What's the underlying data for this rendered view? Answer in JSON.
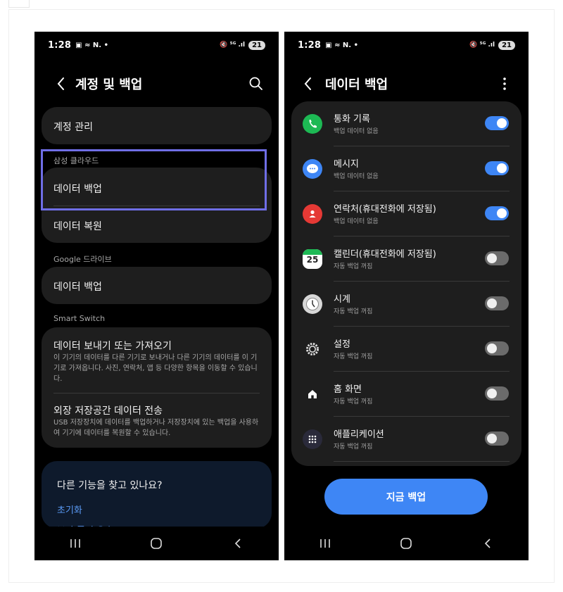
{
  "status_left": {
    "time": "1:28",
    "icons": "▣ ≈ N. •"
  },
  "status_right": {
    "icons": "🔇 ⁵ᴳ .ıl",
    "battery": "21"
  },
  "left_screen": {
    "title": "계정 및 백업",
    "account_management": "계정 관리",
    "samsung_cloud_label": "삼성 클라우드",
    "data_backup": "데이터 백업",
    "data_restore": "데이터 복원",
    "google_drive_label": "Google 드라이브",
    "google_data_backup": "데이터 백업",
    "smart_switch_label": "Smart Switch",
    "send_receive_title": "데이터 보내기 또는 가져오기",
    "send_receive_desc": "이 기기의 데이터를 다른 기기로 보내거나 다른 기기의 데이터를 이 기기로 가져옵니다. 사진, 연락처, 앱 등 다양한 항목을 이동할 수 있습니다.",
    "external_title": "외장 저장공간 데이터 전송",
    "external_desc": "USB 저장장치에 데이터를 백업하거나 저장장치에 있는 백업을 사용하여 기기에 데이터를 복원할 수 있습니다.",
    "help_title": "다른 기능을 찾고 있나요?",
    "help_link": "초기화",
    "help_link_partial": "보안 폴더 유효"
  },
  "right_screen": {
    "title": "데이터 백업",
    "items": [
      {
        "title": "통화 기록",
        "sub": "백업 데이터 없음",
        "icon": "phone-icon",
        "enabled": true,
        "color": "#1db954"
      },
      {
        "title": "메시지",
        "sub": "백업 데이터 없음",
        "icon": "message-icon",
        "enabled": true,
        "color": "#3e86f5"
      },
      {
        "title": "연락처(휴대전화에 저장됨)",
        "sub": "백업 데이터 없음",
        "icon": "contacts-icon",
        "enabled": true,
        "color": "#e53935"
      },
      {
        "title": "캘린더(휴대전화에 저장됨)",
        "sub": "자동 백업 꺼짐",
        "icon": "calendar-icon",
        "enabled": false,
        "color": "#ffffff",
        "badge": "25"
      },
      {
        "title": "시계",
        "sub": "자동 백업 꺼짐",
        "icon": "clock-icon",
        "enabled": false,
        "color": "#d8d8d8"
      },
      {
        "title": "설정",
        "sub": "자동 백업 꺼짐",
        "icon": "settings-icon",
        "enabled": false,
        "color": "#1e1e1e"
      },
      {
        "title": "홈 화면",
        "sub": "자동 백업 꺼짐",
        "icon": "home-icon",
        "enabled": false,
        "color": "#1e1e1e"
      },
      {
        "title": "애플리케이션",
        "sub": "자동 백업 꺼짐",
        "icon": "apps-icon",
        "enabled": false,
        "color": "#2a2a3a"
      }
    ],
    "backup_now": "지금 백업"
  },
  "accent": "#3e86f5",
  "highlight_color": "#6f6ee6"
}
